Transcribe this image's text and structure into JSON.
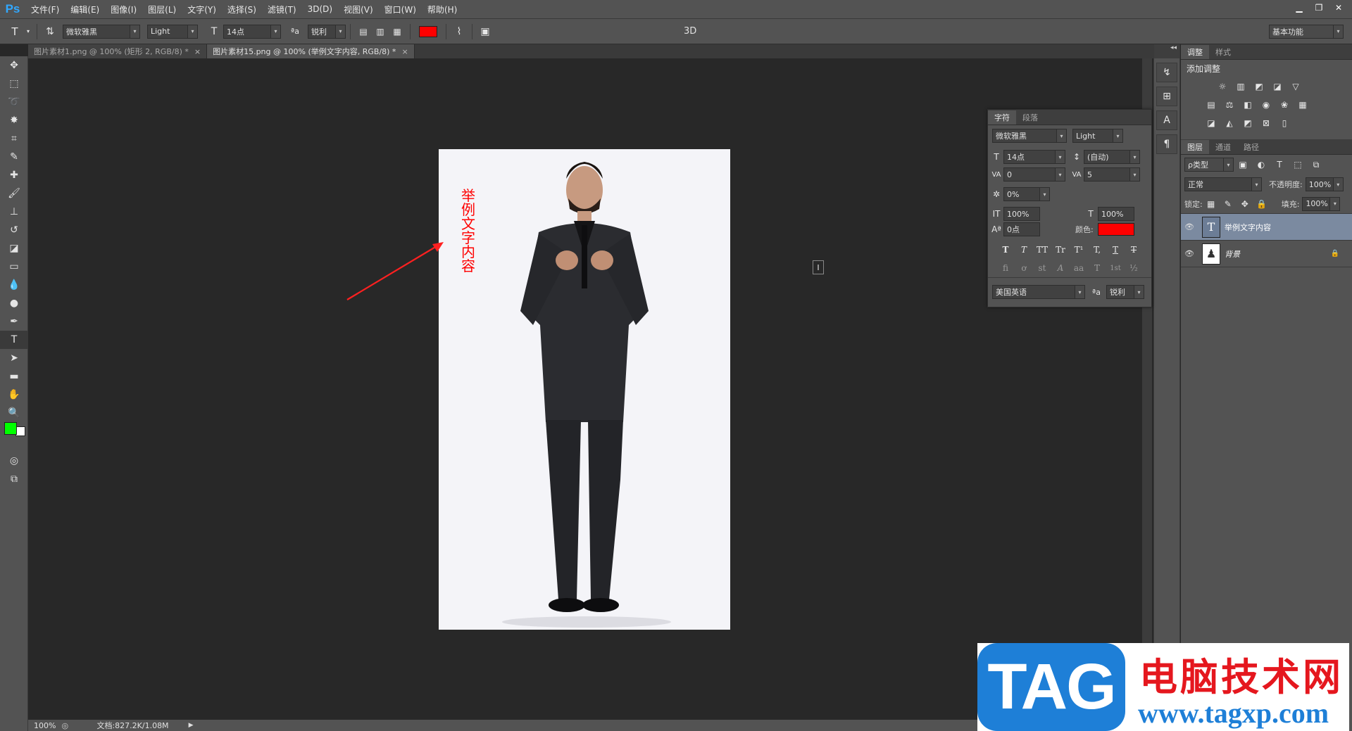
{
  "app": {
    "logo": "Ps"
  },
  "menu": [
    "文件(F)",
    "编辑(E)",
    "图像(I)",
    "图层(L)",
    "文字(Y)",
    "选择(S)",
    "滤镜(T)",
    "3D(D)",
    "视图(V)",
    "窗口(W)",
    "帮助(H)"
  ],
  "window_controls": [
    "minimize-icon",
    "restore-icon",
    "close-icon"
  ],
  "options": {
    "font_family": "微软雅黑",
    "font_style": "Light",
    "font_size": "14点",
    "aa_label": "ªa",
    "antialias": "锐利",
    "text_color": "#ff0000",
    "mode_3d": "3D",
    "workspace": "基本功能"
  },
  "tabs": [
    {
      "label": "图片素材1.png @ 100% (矩形 2, RGB/8) *",
      "close": "×"
    },
    {
      "label": "图片素材15.png @ 100% (举例文字内容, RGB/8) *",
      "close": "×"
    }
  ],
  "canvas": {
    "text_layer": "举例文字内容",
    "text_color": "#ff0000"
  },
  "status": {
    "zoom": "100%",
    "doc": "文档:827.2K/1.08M"
  },
  "colors": {
    "foreground": "#00ff00",
    "background": "#ffffff",
    "accent": "#31a8ff"
  },
  "adjust_panel": {
    "tabs": [
      "调整",
      "样式"
    ],
    "title": "添加调整"
  },
  "char_panel": {
    "tabs": [
      "字符",
      "段落"
    ],
    "font_family": "微软雅黑",
    "font_style": "Light",
    "size": "14点",
    "leading": "(自动)",
    "kerning": "0",
    "tracking": "5",
    "tsume": "0%",
    "vscale": "100%",
    "hscale": "100%",
    "baseline": "0点",
    "color_label": "颜色:",
    "color": "#ff0000",
    "language": "美国英语",
    "aa_label": "ªa",
    "antialias": "锐利",
    "style_buttons": [
      "T",
      "T",
      "TT",
      "Tr",
      "T¹",
      "T,",
      "T",
      "T"
    ],
    "ot_buttons": [
      "fi",
      "ơ",
      "st",
      "A",
      "aa",
      "T",
      "1st",
      "½"
    ]
  },
  "layers_panel": {
    "tabs": [
      "图层",
      "通道",
      "路径"
    ],
    "filter": "ρ类型",
    "blend": "正常",
    "opacity_label": "不透明度:",
    "opacity": "100%",
    "lock_label": "锁定:",
    "fill_label": "填充:",
    "fill": "100%",
    "layers": [
      {
        "name": "举例文字内容",
        "thumb": "T"
      },
      {
        "name": "背景",
        "thumb": "♟"
      }
    ]
  },
  "watermark": {
    "tag": "TAG",
    "cn": "电脑技术网",
    "url": "www.tagxp.com"
  }
}
